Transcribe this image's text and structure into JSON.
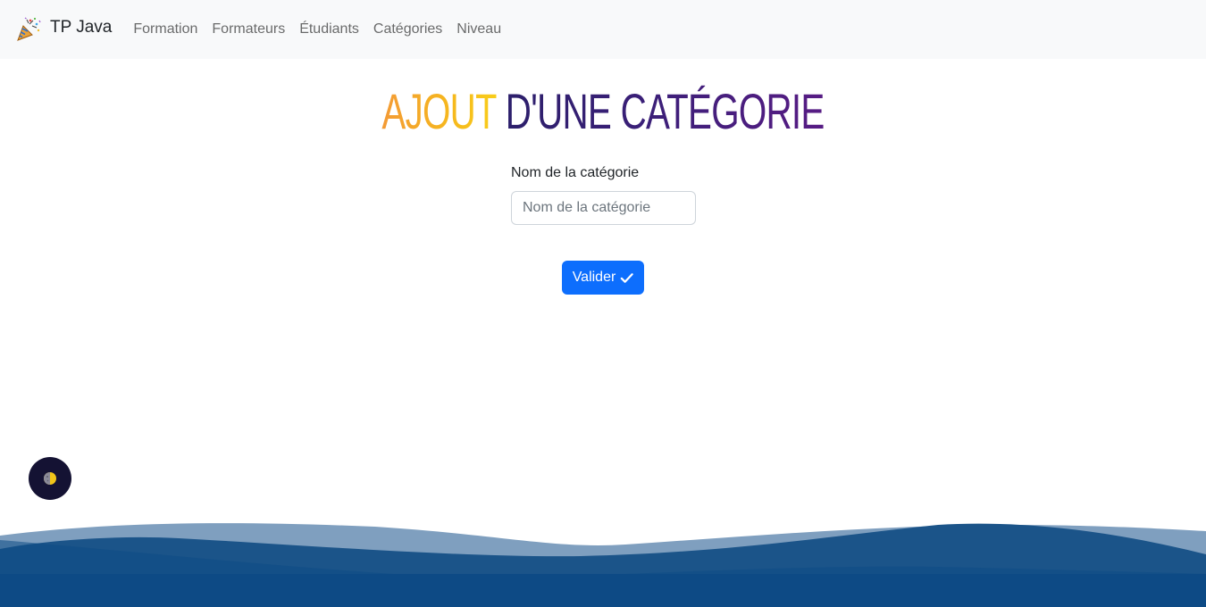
{
  "navbar": {
    "brand": "TP Java",
    "brand_icon": "party-popper-icon",
    "links": [
      "Formation",
      "Formateurs",
      "Étudiants",
      "Catégories",
      "Niveau"
    ]
  },
  "main": {
    "title_part1": "AJOUT",
    "title_part2": "D'UNE CATÉGORIE",
    "field": {
      "label": "Nom de la catégorie",
      "placeholder": "Nom de la catégorie",
      "value": ""
    },
    "submit_label": "Valider",
    "submit_icon": "checkmark-icon"
  },
  "theme_toggle": {
    "icon": "half-moon-icon"
  },
  "colors": {
    "primary": "#0d6efd",
    "navbar_bg": "#f8f9fa",
    "title_orange": "#f6b81d",
    "title_purple": "#3b1f78",
    "wave_light": "#7f9fbf",
    "wave_mid": "#1b5489",
    "wave_dark": "#0d4a85",
    "toggle_bg": "#141233"
  }
}
